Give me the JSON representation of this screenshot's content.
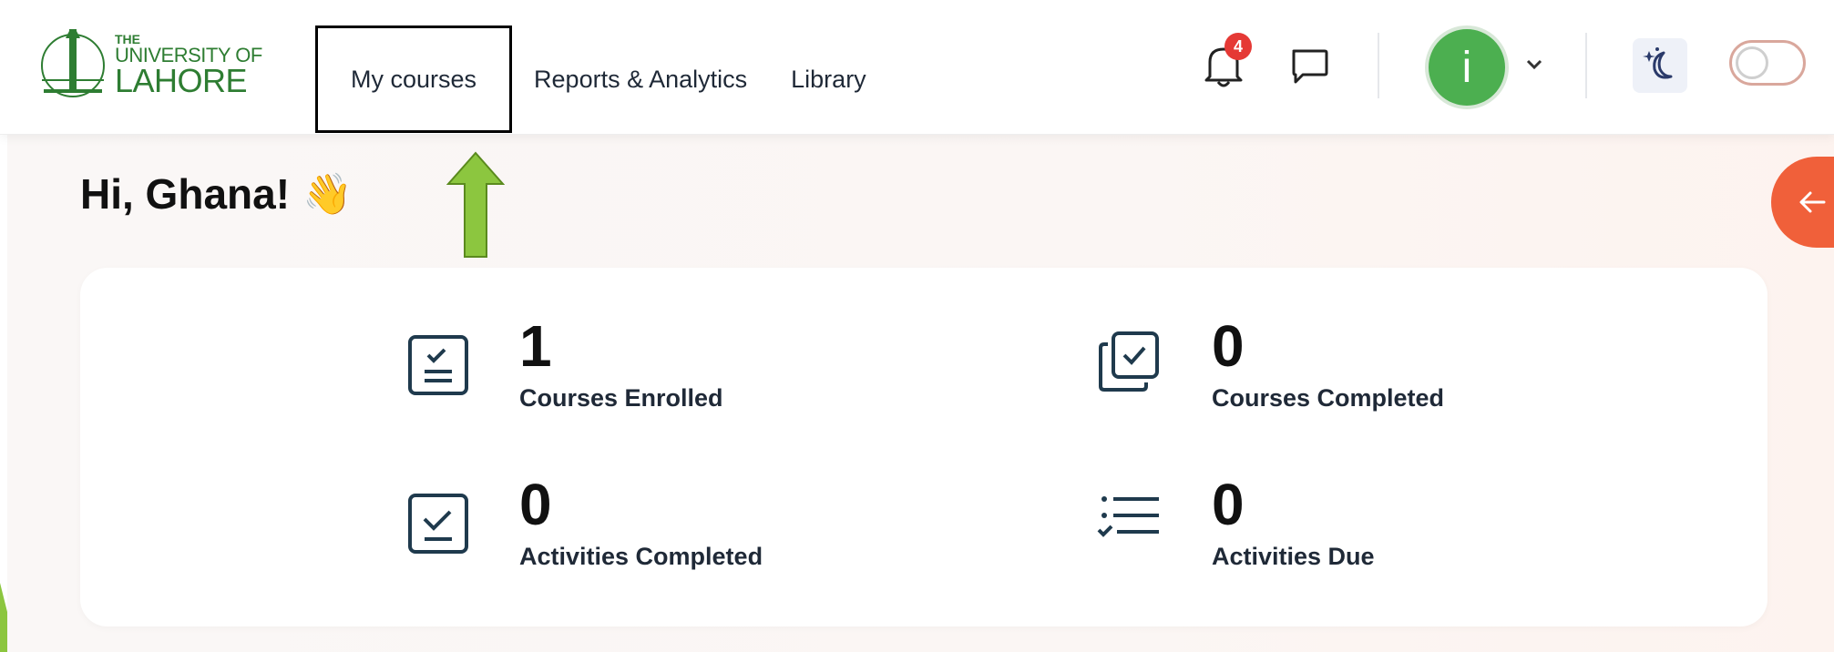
{
  "brand": {
    "line1": "THE",
    "line2": "UNIVERSITY OF",
    "line3": "LAHORE",
    "color": "#2e7d32"
  },
  "nav": {
    "items": [
      {
        "label": "My courses",
        "active": true
      },
      {
        "label": "Reports & Analytics",
        "active": false
      },
      {
        "label": "Library",
        "active": false
      }
    ]
  },
  "header": {
    "notifications_count": "4",
    "avatar_initial": "i",
    "icons": [
      "bell-icon",
      "chat-icon",
      "chevron-down-icon",
      "moon-stars-icon"
    ]
  },
  "greeting": {
    "text": "Hi, Ghana!",
    "emoji": "👋"
  },
  "stats": [
    {
      "value": "1",
      "label": "Courses Enrolled",
      "icon": "checklist-icon"
    },
    {
      "value": "0",
      "label": "Courses Completed",
      "icon": "stacked-check-icon"
    },
    {
      "value": "0",
      "label": "Activities Completed",
      "icon": "check-box-icon"
    },
    {
      "value": "0",
      "label": "Activities Due",
      "icon": "list-check-icon"
    }
  ],
  "colors": {
    "accent": "#f0603a",
    "avatar": "#4caf50",
    "badge": "#e53935",
    "arrow": "#8cc63f",
    "icon_stroke": "#1f3a4d"
  }
}
